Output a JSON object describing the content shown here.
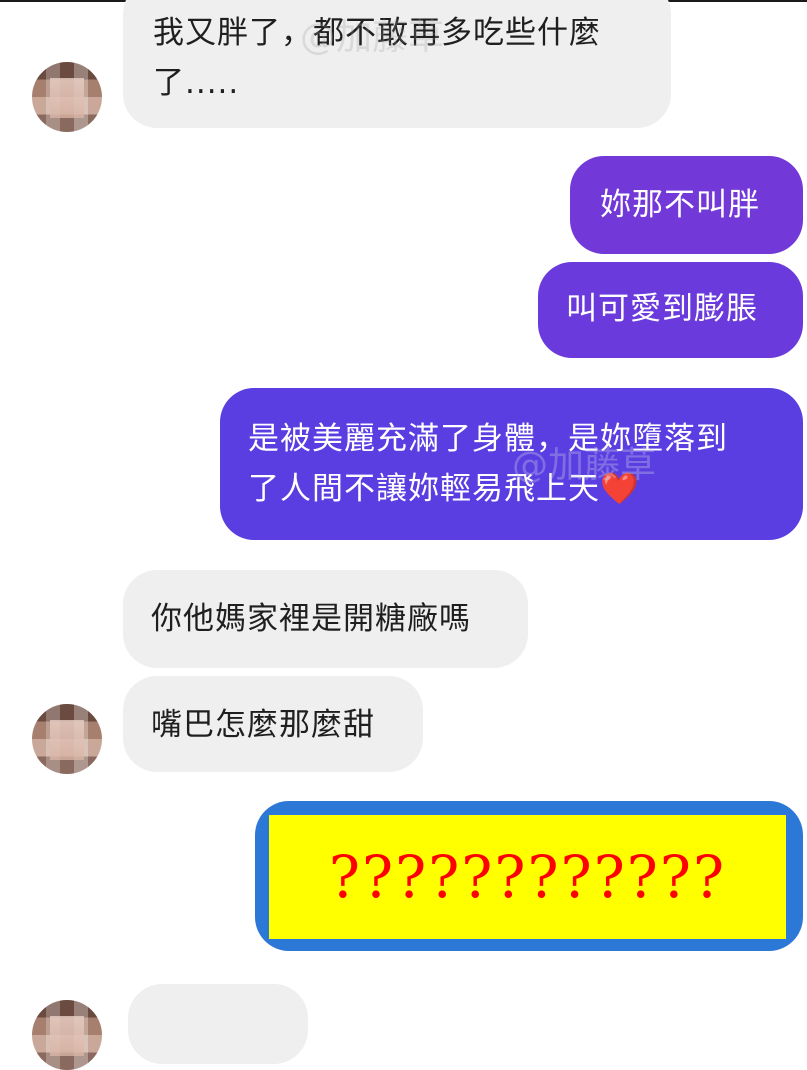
{
  "messages": {
    "m1": "我又胖了，都不敢再多吃些什麼",
    "m1b": "了.....",
    "m2": "妳那不叫胖",
    "m3": "叫可愛到膨脹",
    "m4a": "是被美麗充滿了身體，是妳墮落到",
    "m4b": "了人間不讓妳輕易飛上天",
    "m4_heart": "❤️",
    "m5": "你他媽家裡是開糖廠嗎",
    "m6": "嘴巴怎麼那麼甜",
    "m7": "????????????"
  },
  "watermark": "@加藤草",
  "colors": {
    "incoming_bg": "#efefef",
    "outgoing_top": "#7a3ed6",
    "outgoing_bottom": "#4a3ee0",
    "highlight_border": "#2c78d6",
    "highlight_fill": "#ffff00",
    "highlight_text": "#ff0000"
  }
}
